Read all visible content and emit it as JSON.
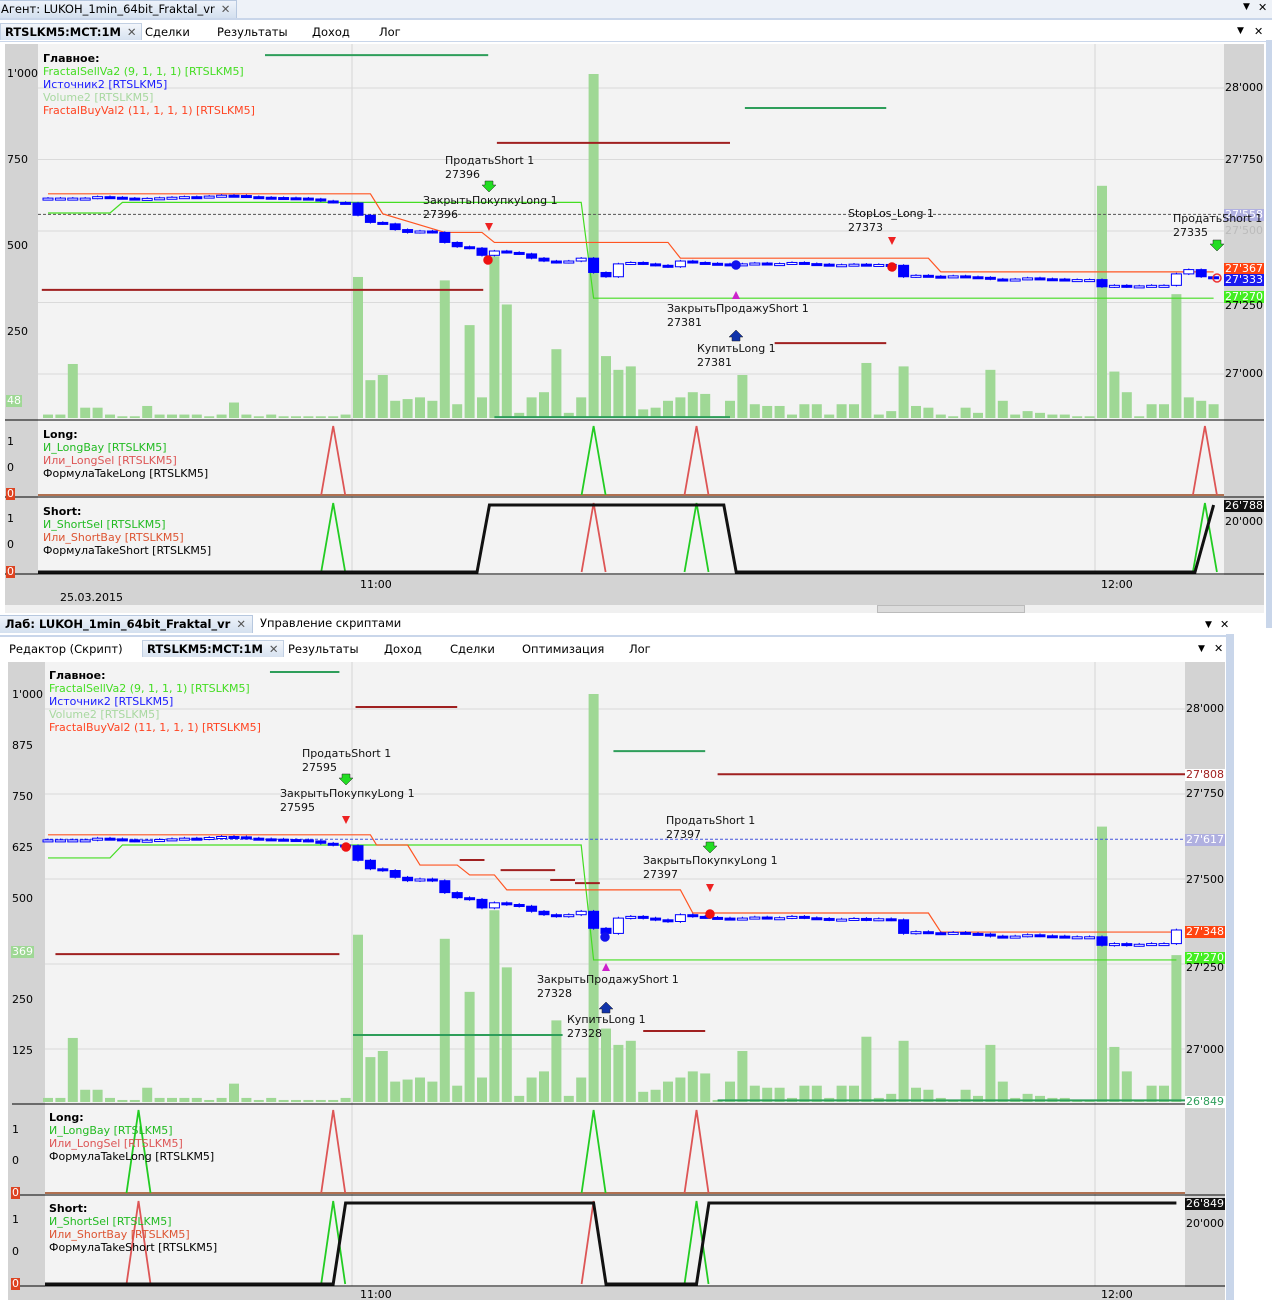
{
  "top_window": {
    "title": "Агент: LUKOH_1min_64bit_Fraktal_vr",
    "tabs": [
      {
        "label": "RTSLKM5:MCT:1M",
        "active": true
      },
      {
        "label": "Сделки"
      },
      {
        "label": "Результаты"
      },
      {
        "label": "Доход"
      },
      {
        "label": "Лог"
      }
    ],
    "legend_main": {
      "title": "Главное:",
      "items": [
        "FractalSellVa2 (9, 1, 1, 1) [RTSLKM5]",
        "Источник2 [RTSLKM5]",
        "Volume2 [RTSLKM5]",
        "FractalBuyVal2 (11, 1, 1, 1) [RTSLKM5]"
      ]
    },
    "legend_long": {
      "title": "Long:",
      "items": [
        "И_LongBay [RTSLKM5]",
        "Или_LongSel [RTSLKM5]",
        "ФормулаTakeLong [RTSLKM5]"
      ]
    },
    "legend_short": {
      "title": "Short:",
      "items": [
        "И_ShortSel [RTSLKM5]",
        "Или_ShortBay [RTSLKM5]",
        "ФормулаTakeShort [RTSLKM5]"
      ]
    },
    "left_axis": [
      "1'000",
      "750",
      "500",
      "250"
    ],
    "volume_tag": "48",
    "long_axis": [
      "1",
      "0",
      "0"
    ],
    "short_axis": [
      "1",
      "0",
      "0"
    ],
    "right_axis": [
      "28'000",
      "27'750",
      "27'500",
      "27'250",
      "27'000"
    ],
    "price_tags": {
      "dashed": "27'558",
      "sell": "27'367",
      "last": "27'333",
      "buy": "27'270"
    },
    "short_tags": {
      "value": "26'788",
      "tick": "20'000"
    },
    "time_labels": [
      "11:00",
      "12:00"
    ],
    "date": "25.03.2015",
    "annotations": [
      {
        "text": "ПродатьShort 1",
        "price": "27396"
      },
      {
        "text": "ЗакрытьПокупкуLong 1",
        "price": "27396"
      },
      {
        "text": "StopLos_Long 1",
        "price": "27373"
      },
      {
        "text": "ПродатьShort 1",
        "price": "27335"
      },
      {
        "text": "ЗакрытьПродажуShort 1",
        "price": "27381"
      },
      {
        "text": "КупитьLong 1",
        "price": "27381"
      }
    ]
  },
  "bottom_window": {
    "title": "Лаб: LUKOH_1min_64bit_Fraktal_vr",
    "title2": "Управление скриптами",
    "tabs": [
      {
        "label": "Редактор (Скрипт)"
      },
      {
        "label": "RTSLKM5:MCT:1M",
        "active": true
      },
      {
        "label": "Результаты"
      },
      {
        "label": "Доход"
      },
      {
        "label": "Сделки"
      },
      {
        "label": "Оптимизация"
      },
      {
        "label": "Лог"
      }
    ],
    "left_axis": [
      "1'000",
      "875",
      "750",
      "625",
      "500",
      "250",
      "125"
    ],
    "volume_tag": "369",
    "right_axis": [
      "28'000",
      "27'750",
      "27'500",
      "27'250",
      "27'000"
    ],
    "price_tags": {
      "level": "27'808",
      "dashed": "27'617",
      "sell": "27'348",
      "buy": "27'270",
      "low": "26'849"
    },
    "short_tags": {
      "value": "26'849",
      "tick": "20'000"
    },
    "time_labels": [
      "11:00",
      "12:00"
    ],
    "annotations": [
      {
        "text": "ПродатьShort 1",
        "price": "27595"
      },
      {
        "text": "ЗакрытьПокупкуLong 1",
        "price": "27595"
      },
      {
        "text": "ПродатьShort 1",
        "price": "27397"
      },
      {
        "text": "ЗакрытьПокупкуLong 1",
        "price": "27397"
      },
      {
        "text": "ЗакрытьПродажуShort 1",
        "price": "27328"
      },
      {
        "text": "КупитьLong 1",
        "price": "27328"
      }
    ]
  },
  "colors": {
    "candle": "#0000ff",
    "volume": "#9fd895",
    "sell_line": "#44dd22",
    "buy_line": "#ff5522",
    "level_red": "#a02020",
    "level_green": "#2e9e5a",
    "signal_green": "#22cc22",
    "signal_red": "#dd5555"
  },
  "chart_data": {
    "type": "candlestick",
    "start_time": "10:35",
    "interval": "1 min",
    "closes": [
      27615,
      27615,
      27615,
      27615,
      27620,
      27618,
      27615,
      27612,
      27614,
      27616,
      27618,
      27620,
      27618,
      27622,
      27625,
      27624,
      27620,
      27618,
      27617,
      27616,
      27615,
      27612,
      27605,
      27600,
      27598,
      27555,
      27530,
      27525,
      27505,
      27495,
      27500,
      27495,
      27460,
      27445,
      27440,
      27415,
      27430,
      27425,
      27420,
      27405,
      27395,
      27390,
      27395,
      27405,
      27355,
      27340,
      27385,
      27390,
      27385,
      27380,
      27375,
      27395,
      27390,
      27387,
      27385,
      27383,
      27385,
      27388,
      27385,
      27386,
      27390,
      27386,
      27384,
      27380,
      27382,
      27384,
      27380,
      27383,
      27380,
      27340,
      27345,
      27342,
      27340,
      27343,
      27340,
      27338,
      27332,
      27330,
      27332,
      27336,
      27333,
      27332,
      27330,
      27330,
      27330,
      27305,
      27310,
      27305,
      27308,
      27310,
      27310,
      27350,
      27365,
      27340,
      27335
    ],
    "volumes": [
      10,
      10,
      157,
      30,
      30,
      10,
      5,
      5,
      35,
      10,
      10,
      10,
      10,
      5,
      10,
      45,
      10,
      5,
      10,
      5,
      5,
      5,
      5,
      5,
      10,
      410,
      110,
      125,
      50,
      55,
      60,
      50,
      400,
      40,
      270,
      60,
      470,
      330,
      15,
      60,
      75,
      200,
      15,
      60,
      1000,
      180,
      140,
      150,
      25,
      30,
      50,
      60,
      75,
      70,
      5,
      50,
      125,
      40,
      35,
      35,
      10,
      40,
      40,
      10,
      40,
      40,
      160,
      10,
      20,
      150,
      35,
      30,
      10,
      5,
      30,
      15,
      140,
      50,
      10,
      20,
      15,
      10,
      10,
      5,
      5,
      675,
      135,
      75,
      5,
      40,
      40,
      360,
      60,
      50,
      40
    ],
    "top_lines": {
      "buy": [
        [
          0,
          27630
        ],
        [
          26,
          27630
        ],
        [
          27,
          27560
        ],
        [
          32,
          27495
        ],
        [
          35,
          27495
        ],
        [
          36,
          27460
        ],
        [
          50,
          27460
        ],
        [
          51,
          27405
        ],
        [
          71,
          27405
        ],
        [
          72,
          27357
        ],
        [
          94,
          27357
        ]
      ],
      "sell": [
        [
          0,
          27563
        ],
        [
          5,
          27563
        ],
        [
          6,
          27600
        ],
        [
          43,
          27600
        ],
        [
          44,
          27265
        ],
        [
          94,
          27265
        ]
      ],
      "levels": [
        [
          28115,
          17.5,
          35.5,
          "g"
        ],
        [
          27930,
          56.2,
          67.6,
          "g"
        ],
        [
          27808,
          36.2,
          55,
          "r"
        ],
        [
          27294,
          -0.5,
          35.1,
          "r"
        ],
        [
          27108,
          58.6,
          67.6,
          "r"
        ],
        [
          26849,
          36,
          55,
          "g"
        ]
      ],
      "dashed": 27558,
      "long_spikes": [
        [
          23,
          "r"
        ],
        [
          44,
          "g"
        ],
        [
          52.3,
          "r"
        ],
        [
          93.3,
          "r"
        ]
      ],
      "short_spikes": [
        [
          23,
          "g"
        ],
        [
          44,
          "r"
        ],
        [
          52.3,
          "g"
        ],
        [
          93.3,
          "g"
        ]
      ],
      "short_take": [
        [
          -1,
          0
        ],
        [
          34.6,
          0
        ],
        [
          35.6,
          1
        ],
        [
          54.5,
          1
        ],
        [
          55.5,
          0
        ],
        [
          92.5,
          0
        ],
        [
          94,
          1
        ]
      ]
    },
    "bottom_lines": {
      "buy": [
        [
          0,
          27630
        ],
        [
          26,
          27630
        ],
        [
          26.5,
          27600
        ],
        [
          29,
          27600
        ],
        [
          30,
          27541
        ],
        [
          33,
          27541
        ],
        [
          34,
          27512
        ],
        [
          36,
          27512
        ],
        [
          37,
          27468
        ],
        [
          51,
          27468
        ],
        [
          52,
          27400
        ],
        [
          71,
          27400
        ],
        [
          72,
          27344
        ],
        [
          91,
          27344
        ]
      ],
      "sell": [
        [
          0,
          27562
        ],
        [
          5,
          27562
        ],
        [
          6,
          27600
        ],
        [
          43,
          27600
        ],
        [
          44,
          27262
        ],
        [
          91,
          27262
        ]
      ],
      "levels": [
        [
          28109,
          17.9,
          23.5,
          "g"
        ],
        [
          28006,
          24.8,
          33,
          "r"
        ],
        [
          27876,
          45.6,
          53,
          "g"
        ],
        [
          27808,
          54,
          91.7,
          "r"
        ],
        [
          27279,
          0.6,
          23.5,
          "r"
        ],
        [
          27041,
          24.6,
          41.5,
          "g"
        ],
        [
          27053,
          48,
          53,
          "r"
        ],
        [
          27556,
          33.2,
          35.2,
          "r"
        ],
        [
          27526,
          36.5,
          40.9,
          "r"
        ],
        [
          27497,
          40.5,
          42.5,
          "r"
        ],
        [
          27488,
          42.5,
          44.5,
          "r"
        ],
        [
          26849,
          54,
          91.7,
          "g"
        ]
      ],
      "dashed": 27617,
      "long_spikes": [
        [
          7.3,
          "g"
        ],
        [
          23,
          "r"
        ],
        [
          44,
          "g"
        ],
        [
          52.3,
          "r"
        ]
      ],
      "short_spikes": [
        [
          7.3,
          "r"
        ],
        [
          23,
          "g"
        ],
        [
          44,
          "r"
        ],
        [
          52.3,
          "g"
        ]
      ],
      "short_take": [
        [
          -1,
          0
        ],
        [
          23,
          0
        ],
        [
          24,
          1
        ],
        [
          44,
          1
        ],
        [
          45,
          0
        ],
        [
          52.3,
          0
        ],
        [
          53.3,
          1
        ],
        [
          91,
          1
        ]
      ]
    }
  }
}
